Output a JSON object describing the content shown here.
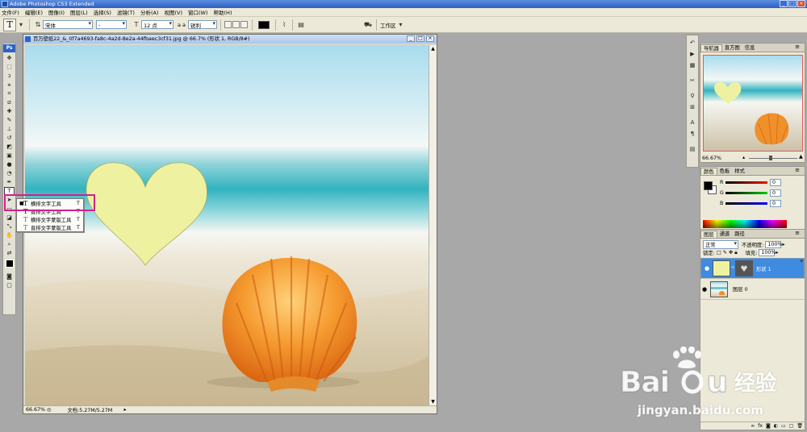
{
  "window": {
    "title": "Adobe Photoshop CS3 Extended"
  },
  "menu": [
    "文件(F)",
    "编辑(E)",
    "图像(I)",
    "图层(L)",
    "选择(S)",
    "滤镜(T)",
    "分析(A)",
    "视图(V)",
    "窗口(W)",
    "帮助(H)"
  ],
  "options": {
    "tool_glyph": "T",
    "font_family": "宋体",
    "font_style": "-",
    "font_size": "12 点",
    "aa_label": "a a",
    "aa_mode": "锐利",
    "workspace": "工作区"
  },
  "document": {
    "title": "百万壁纸22_&_0f7a4693-fa8c-4a2d-8e2a-44fbaec3cf31.jpg @ 66.7% (形状 1, RGB/8#)",
    "zoom": "66.67%",
    "doc_size": "文档:5.27M/5.27M"
  },
  "tool_flyout": {
    "items": [
      {
        "label": "横排文字工具",
        "key": "T",
        "active": true
      },
      {
        "label": "直排文字工具",
        "key": "T",
        "active": false
      },
      {
        "label": "横排文字蒙版工具",
        "key": "T",
        "active": false
      },
      {
        "label": "直排文字蒙版工具",
        "key": "T",
        "active": false
      }
    ]
  },
  "navigator_panel": {
    "tabs": [
      "导航器",
      "直方图",
      "信息"
    ],
    "zoom": "66.67%"
  },
  "color_panel": {
    "tabs": [
      "颜色",
      "色板",
      "样式"
    ],
    "channels": [
      {
        "label": "R",
        "value": "0"
      },
      {
        "label": "G",
        "value": "0"
      },
      {
        "label": "B",
        "value": "0"
      }
    ]
  },
  "layers_panel": {
    "tabs": [
      "图层",
      "通道",
      "路径"
    ],
    "blend_mode": "正常",
    "opacity_label": "不透明度:",
    "opacity": "100%",
    "lock_label": "锁定:",
    "fill_label": "填充:",
    "fill": "100%",
    "layers": [
      {
        "name": "形状 1",
        "selected": true
      },
      {
        "name": "图层 0",
        "selected": false
      }
    ]
  },
  "watermark": {
    "brand_cn": "经验",
    "site": "jingyan.baidu.com"
  },
  "colors": {
    "heart": "#eef2a0",
    "selection_highlight": "#d2208d",
    "layer_selected": "#3f8be0"
  }
}
